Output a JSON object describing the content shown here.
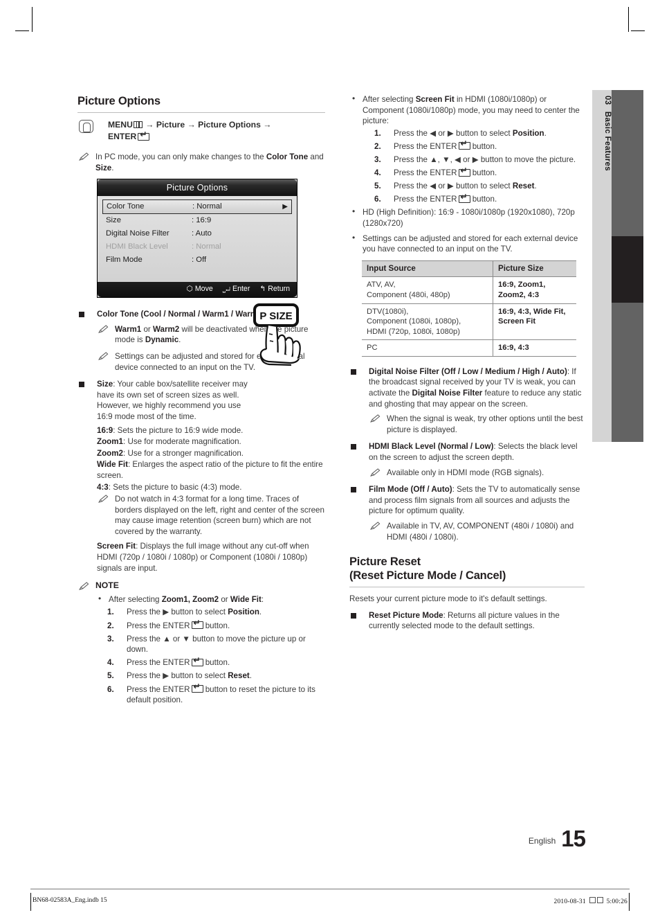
{
  "side_tab": {
    "number": "03",
    "title": "Basic Features"
  },
  "page_footer": {
    "language": "English",
    "page_number": "15",
    "file_name": "BN68-02583A_Eng.indb  15",
    "timestamp": "2010-08-31",
    "time": "5:00:26"
  },
  "left_column": {
    "heading": "Picture Options",
    "menu_path": {
      "menu_label": "MENU",
      "arrow": "→",
      "step1": "Picture",
      "step2": "Picture Options",
      "enter_label": "ENTER"
    },
    "pc_note": {
      "prefix": "In PC mode, you can only make changes to the ",
      "bold1": "Color Tone",
      "middle": " and ",
      "bold2": "Size",
      "suffix": "."
    },
    "osd": {
      "title": "Picture Options",
      "rows": [
        {
          "key": "Color Tone",
          "value": ": Normal",
          "selected": true,
          "dim": false,
          "arrow": "▶"
        },
        {
          "key": "Size",
          "value": ": 16:9",
          "selected": false,
          "dim": false,
          "arrow": ""
        },
        {
          "key": "Digital Noise Filter",
          "value": ": Auto",
          "selected": false,
          "dim": false,
          "arrow": ""
        },
        {
          "key": "HDMI Black Level",
          "value": ": Normal",
          "selected": false,
          "dim": true,
          "arrow": ""
        },
        {
          "key": "Film Mode",
          "value": ": Off",
          "selected": false,
          "dim": false,
          "arrow": ""
        }
      ],
      "footer": {
        "move": "Move",
        "enter": "Enter",
        "return": "Return"
      }
    },
    "color_tone": {
      "title": "Color Tone (Cool / Normal / Warm1 / Warm2)",
      "note1": {
        "b1": "Warm1",
        "t1": " or ",
        "b2": "Warm2",
        "t2": " will be deactivated when the picture mode is ",
        "b3": "Dynamic",
        "t3": "."
      },
      "note2": "Settings can be adjusted and stored for each external device connected to an input on the TV."
    },
    "size": {
      "bold": "Size",
      "text": ": Your cable box/satellite receiver may have its own set of screen sizes as well. However, we highly recommend you use 16:9 mode most of the time.",
      "remote_button_label": "P SIZE",
      "items": [
        {
          "term": "16:9",
          "desc": ": Sets the picture to 16:9 wide mode."
        },
        {
          "term": "Zoom1",
          "desc": ": Use for moderate magnification."
        },
        {
          "term": "Zoom2",
          "desc": ": Use for a stronger magnification."
        },
        {
          "term": "Wide Fit",
          "desc": ": Enlarges the aspect ratio of the picture to fit the entire screen."
        },
        {
          "term": "4:3",
          "desc": ": Sets the picture to basic (4:3) mode."
        }
      ],
      "warn_43": "Do not watch in 4:3 format for a long time. Traces of borders displayed on the left, right and center of the screen may cause image retention (screen burn) which are not covered by the warranty.",
      "screen_fit": {
        "term": "Screen Fit",
        "desc": ": Displays the full image without any cut-off when HDMI (720p / 1080i / 1080p) or Component (1080i / 1080p) signals are input."
      }
    },
    "note": {
      "heading": "NOTE",
      "bullet": {
        "pre": "After selecting ",
        "b1": "Zoom1, Zoom2",
        "mid": " or ",
        "b2": "Wide Fit",
        "post": ":"
      },
      "steps": [
        {
          "pre": "Press the ▶ button to select ",
          "bold": "Position",
          "post": "."
        },
        {
          "pre": "Press the ENTER",
          "bold": "",
          "post": " button.",
          "enter": true
        },
        {
          "pre": "Press the ▲ or ▼ button to move the picture up or down.",
          "bold": "",
          "post": ""
        },
        {
          "pre": "Press the ENTER",
          "bold": "",
          "post": " button.",
          "enter": true
        },
        {
          "pre": "Press the ▶ button to select ",
          "bold": "Reset",
          "post": "."
        },
        {
          "pre": "Press the ENTER",
          "bold": "",
          "post": " button to reset the picture to its default position.",
          "enter": true
        }
      ]
    }
  },
  "right_column": {
    "screen_fit_note": {
      "pre": "After selecting ",
      "bold": "Screen Fit",
      "post": " in HDMI (1080i/1080p) or Component (1080i/1080p) mode, you may need to center the picture:",
      "steps": [
        {
          "pre": "Press the ◀ or ▶ button to select ",
          "bold": "Position",
          "post": ".",
          "enter": false
        },
        {
          "pre": "Press the ENTER",
          "bold": "",
          "post": " button.",
          "enter": true
        },
        {
          "pre": "Press the ▲, ▼, ◀ or ▶ button to move the picture.",
          "bold": "",
          "post": "",
          "enter": false
        },
        {
          "pre": "Press the ENTER",
          "bold": "",
          "post": " button.",
          "enter": true
        },
        {
          "pre": "Press the ◀ or ▶ button to select ",
          "bold": "Reset",
          "post": ".",
          "enter": false
        },
        {
          "pre": "Press the ENTER",
          "bold": "",
          "post": " button.",
          "enter": true
        }
      ]
    },
    "hd_note": "HD (High Definition): 16:9 - 1080i/1080p (1920x1080), 720p (1280x720)",
    "settings_note": "Settings can be adjusted and stored for each external device you have connected to an input on the TV.",
    "table": {
      "headers": [
        "Input Source",
        "Picture Size"
      ],
      "rows": [
        {
          "source": "ATV, AV,\nComponent (480i, 480p)",
          "size": "16:9, Zoom1,\nZoom2, 4:3"
        },
        {
          "source": "DTV(1080i),\nComponent (1080i, 1080p),\nHDMI (720p, 1080i, 1080p)",
          "size": "16:9, 4:3, Wide Fit,\nScreen Fit"
        },
        {
          "source": "PC",
          "size": "16:9, 4:3"
        }
      ]
    },
    "dnf": {
      "bold": "Digital Noise Filter (Off / Low / Medium / High / Auto)",
      "t1": ": If the broadcast signal received by your TV is weak, you can activate the ",
      "b2": "Digital Noise Filter",
      "t2": " feature to reduce any static and ghosting that may appear on the screen.",
      "note": "When the signal is weak, try other options until the best picture is displayed."
    },
    "hdmi_black": {
      "bold": "HDMI Black Level (Normal / Low)",
      "text": ": Selects the black level on the screen to adjust the screen depth.",
      "note": "Available only in HDMI mode (RGB signals)."
    },
    "film_mode": {
      "bold": "Film Mode (Off / Auto)",
      "text": ": Sets the TV to automatically sense and process film signals from all sources and adjusts the picture for optimum quality.",
      "note": "Available in TV, AV, COMPONENT (480i / 1080i) and HDMI (480i / 1080i)."
    },
    "picture_reset": {
      "heading_line1": "Picture Reset",
      "heading_line2": "(Reset Picture Mode / Cancel)",
      "intro": "Resets your current picture mode to it's default settings.",
      "bold": "Reset Picture Mode",
      "text": ": Returns all picture values in the currently selected mode to the default settings."
    }
  }
}
